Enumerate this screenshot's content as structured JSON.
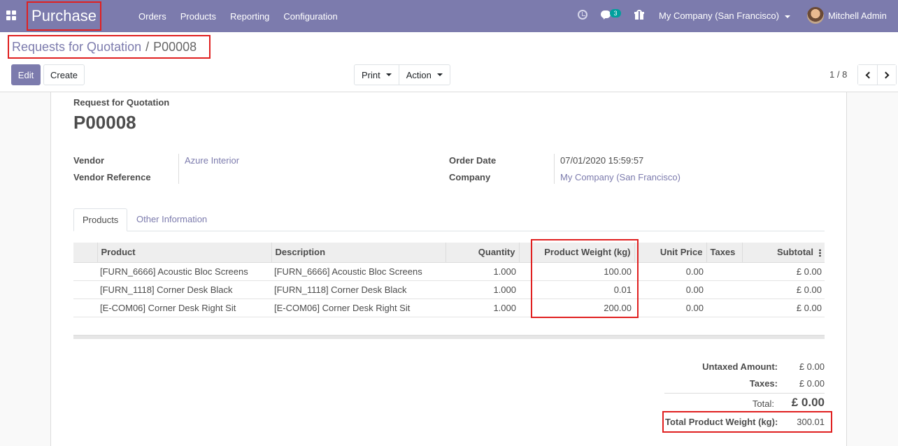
{
  "navbar": {
    "app_name": "Purchase",
    "menu": [
      "Orders",
      "Products",
      "Reporting",
      "Configuration"
    ],
    "chat_count": "3",
    "company": "My Company (San Francisco)",
    "user": "Mitchell Admin",
    "accent_color": "#7c7bad"
  },
  "breadcrumb": {
    "parent": "Requests for Quotation",
    "separator": "/",
    "current": "P00008"
  },
  "toolbar": {
    "edit_label": "Edit",
    "create_label": "Create",
    "print_label": "Print",
    "action_label": "Action",
    "pager": "1 / 8"
  },
  "form": {
    "doc_label": "Request for Quotation",
    "doc_number": "P00008",
    "vendor_label": "Vendor",
    "vendor_value": "Azure Interior",
    "vendor_ref_label": "Vendor Reference",
    "vendor_ref_value": "",
    "order_date_label": "Order Date",
    "order_date_value": "07/01/2020 15:59:57",
    "company_label": "Company",
    "company_value": "My Company (San Francisco)"
  },
  "tabs": [
    "Products",
    "Other Information"
  ],
  "lines": {
    "headers": [
      "Product",
      "Description",
      "Quantity",
      "Product Weight (kg)",
      "Unit Price",
      "Taxes",
      "Subtotal"
    ],
    "rows": [
      {
        "product": "[FURN_6666] Acoustic Bloc Screens",
        "description": "[FURN_6666] Acoustic Bloc Screens",
        "quantity": "1.000",
        "weight": "100.00",
        "unit_price": "0.00",
        "taxes": "",
        "subtotal": "£ 0.00"
      },
      {
        "product": "[FURN_1118] Corner Desk Black",
        "description": "[FURN_1118] Corner Desk Black",
        "quantity": "1.000",
        "weight": "0.01",
        "unit_price": "0.00",
        "taxes": "",
        "subtotal": "£ 0.00"
      },
      {
        "product": "[E-COM06] Corner Desk Right Sit",
        "description": "[E-COM06] Corner Desk Right Sit",
        "quantity": "1.000",
        "weight": "200.00",
        "unit_price": "0.00",
        "taxes": "",
        "subtotal": "£ 0.00"
      }
    ]
  },
  "totals": {
    "untaxed_label": "Untaxed Amount:",
    "untaxed_value": "£ 0.00",
    "taxes_label": "Taxes:",
    "taxes_value": "£ 0.00",
    "total_label": "Total:",
    "total_value": "£ 0.00",
    "weight_label": "Total Product Weight (kg):",
    "weight_value": "300.01"
  }
}
